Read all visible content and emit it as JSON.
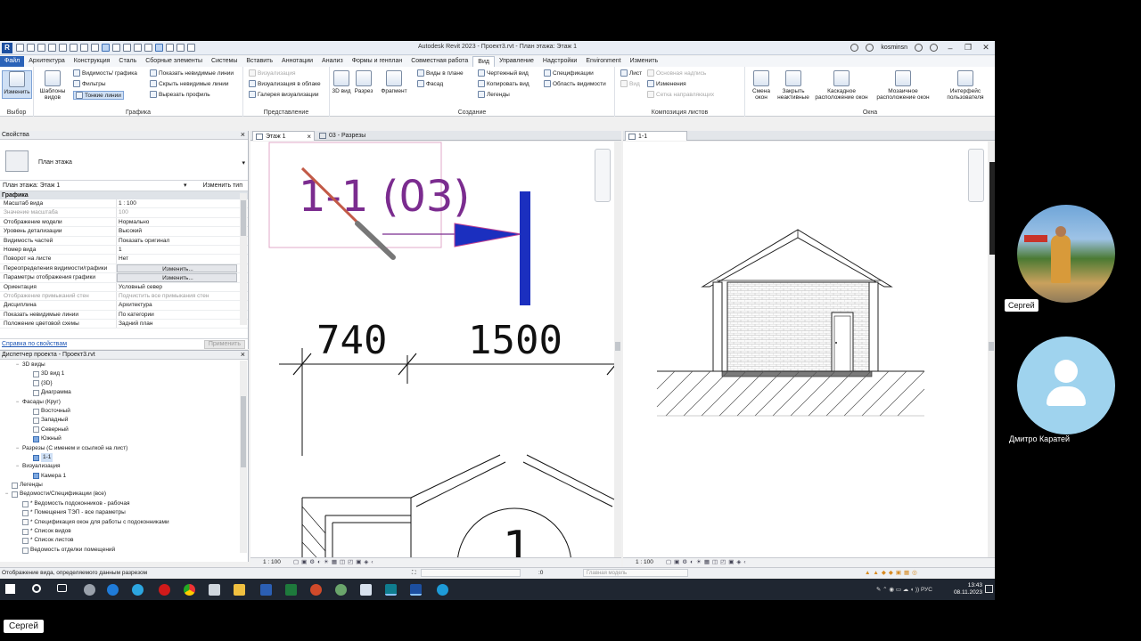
{
  "window": {
    "title": "Autodesk Revit 2023 - Проект3.rvt - План этажа: Этаж 1",
    "user": "kosminsn",
    "logo": "R"
  },
  "menu_tabs": [
    "Файл",
    "Архитектура",
    "Конструкция",
    "Сталь",
    "Сборные элементы",
    "Системы",
    "Вставить",
    "Аннотации",
    "Анализ",
    "Формы и генплан",
    "Совместная работа",
    "Вид",
    "Управление",
    "Надстройки",
    "Environment",
    "Изменить"
  ],
  "ribbon": {
    "select": {
      "modify": "Изменить",
      "group": "Выбор"
    },
    "graphics": {
      "templates": "Шаблоны видов",
      "visibility": "Видимость/ графика",
      "filters": "Фильтры",
      "thin_lines": "Тонкие линии",
      "show_hidden": "Показать невидимые линии",
      "hide_hidden": "Скрыть невидимые линии",
      "cut_profile": "Вырезать профиль",
      "group": "Графика"
    },
    "presentation": {
      "render": "Визуализация",
      "cloud_render": "Визуализация в облаке",
      "gallery": "Галерея визуализации",
      "group": "Представление"
    },
    "create": {
      "view3d": "3D вид",
      "section": "Разрез",
      "callout": "Фрагмент",
      "plan_views": "Виды в плане",
      "elevation": "Фасад",
      "drafting": "Чертежный вид",
      "duplicate": "Копировать вид",
      "legends": "Легенды",
      "schedules": "Спецификации",
      "scope_box": "Область видимости",
      "group": "Создание"
    },
    "sheet": {
      "sheet": "Лист",
      "view": "Вид",
      "title_block": "Основная надпись",
      "revisions": "Изменения",
      "guide_grid": "Сетка направляющих",
      "group": "Композиция листов"
    },
    "windows": {
      "switch": "Смена окон",
      "close_inactive": "Закрыть неактивные",
      "cascade": "Каскадное расположение окон",
      "tile": "Мозаичное расположение окон",
      "ui": "Интерфейс пользователя",
      "group": "Окна"
    }
  },
  "properties": {
    "header": "Свойства",
    "type_name": "План этажа",
    "selector": "План этажа: Этаж 1",
    "edit_type": "Изменить тип",
    "group": "Графика",
    "rows": [
      {
        "k": "Масштаб вида",
        "v": "1 : 100"
      },
      {
        "k": "Значение масштаба",
        "v": "100",
        "dim": true
      },
      {
        "k": "Отображение модели",
        "v": "Нормально"
      },
      {
        "k": "Уровень детализации",
        "v": "Высокий"
      },
      {
        "k": "Видимость частей",
        "v": "Показать оригинал"
      },
      {
        "k": "Номер вида",
        "v": "1"
      },
      {
        "k": "Поворот на листе",
        "v": "Нет"
      },
      {
        "k": "Переопределения видимости/графики",
        "v": "Изменить...",
        "btn": true
      },
      {
        "k": "Параметры отображения графики",
        "v": "Изменить...",
        "btn": true
      },
      {
        "k": "Ориентация",
        "v": "Условный север"
      },
      {
        "k": "Отображение примыканий стен",
        "v": "Подчистить все примыкания стен",
        "dim": true
      },
      {
        "k": "Дисциплина",
        "v": "Архитектура"
      },
      {
        "k": "Показать невидимые линии",
        "v": "По категории"
      },
      {
        "k": "Положение цветовой схемы",
        "v": "Задний план"
      }
    ],
    "help_link": "Справка по свойствам",
    "apply": "Применить"
  },
  "project_browser": {
    "header": "Диспетчер проекта - Проект3.rvt",
    "items": [
      {
        "label": "3D виды",
        "level": 1,
        "toggle": "−"
      },
      {
        "label": "3D вид 1",
        "level": 2,
        "box": "plain"
      },
      {
        "label": "{3D}",
        "level": 2,
        "box": "plain"
      },
      {
        "label": "Диаграмма",
        "level": 2,
        "box": "plain"
      },
      {
        "label": "Фасады (Круг)",
        "level": 1,
        "toggle": "−"
      },
      {
        "label": "Восточный",
        "level": 2,
        "box": "plain"
      },
      {
        "label": "Западный",
        "level": 2,
        "box": "plain"
      },
      {
        "label": "Северный",
        "level": 2,
        "box": "plain"
      },
      {
        "label": "Южный",
        "level": 2,
        "box": "blue"
      },
      {
        "label": "Разрезы (С именем и ссылкой на лист)",
        "level": 1,
        "toggle": "−"
      },
      {
        "label": "1-1",
        "level": 2,
        "box": "blue",
        "sel": true
      },
      {
        "label": "Визуализация",
        "level": 1,
        "toggle": "−"
      },
      {
        "label": "Камера 1",
        "level": 2,
        "box": "blue"
      },
      {
        "label": "Легенды",
        "level": 0,
        "box": "grid"
      },
      {
        "label": "Ведомости/Спецификации (все)",
        "level": 0,
        "box": "grid",
        "toggle": "−"
      },
      {
        "label": "* Ведомость подоконников - рабочая",
        "level": 1,
        "box": "plain"
      },
      {
        "label": "* Помещения ТЭП - все параметры",
        "level": 1,
        "box": "plain"
      },
      {
        "label": "* Спецификация окон для работы с подоконниками",
        "level": 1,
        "box": "plain"
      },
      {
        "label": "* Список видов",
        "level": 1,
        "box": "plain"
      },
      {
        "label": "* Список листов",
        "level": 1,
        "box": "plain"
      },
      {
        "label": "Ведомость отделки помещений",
        "level": 1,
        "box": "plain"
      }
    ]
  },
  "views": {
    "tab1": "Этаж 1",
    "tab2": "03 - Разрезы",
    "tab3": "1-1",
    "section_tag": "1-1 (03)",
    "dim_left": "740",
    "dim_right": "1500",
    "room_number": "1",
    "scale1": "1 : 100",
    "scale2": "1 : 100"
  },
  "status": {
    "message": "Отображение вида, определяемого данным разрезом",
    "coord": ":0",
    "model": "Главная модель"
  },
  "taskbar": {
    "lang": "РУС",
    "time": "13:43",
    "date": "08.11.2023"
  },
  "participants": {
    "p1": "Сергей",
    "p2": "Дмитро Каратей",
    "self": "Сергей"
  }
}
